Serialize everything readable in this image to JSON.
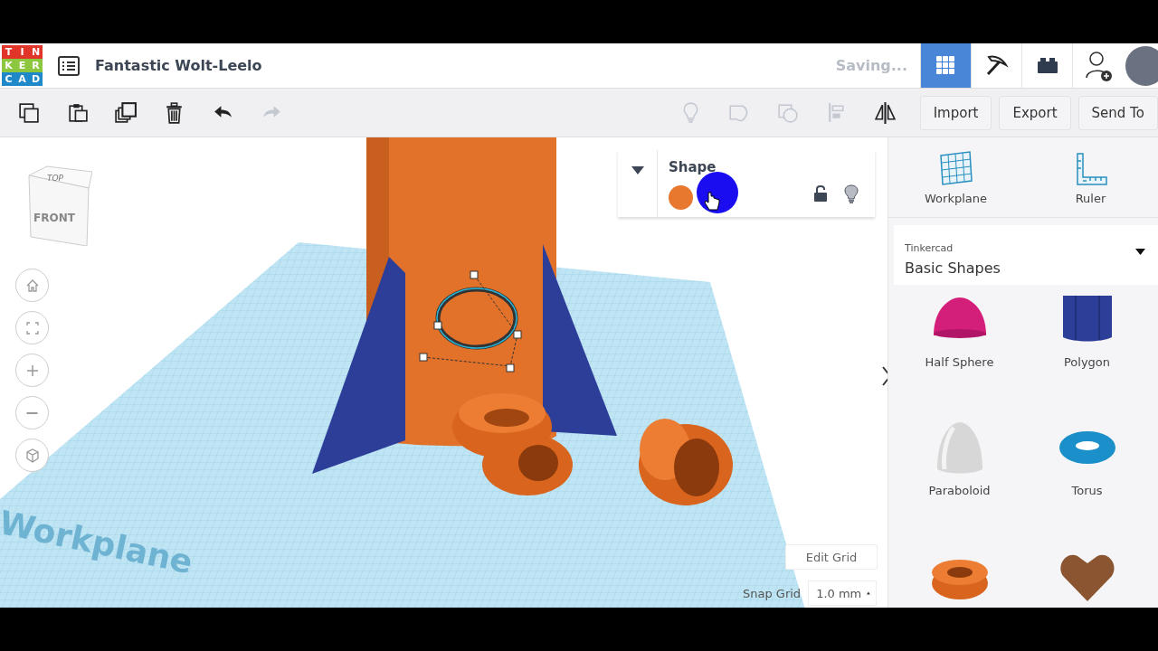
{
  "header": {
    "logo_letters": [
      "T",
      "I",
      "N",
      "K",
      "E",
      "R",
      "C",
      "A",
      "D"
    ],
    "title": "Fantastic Wolt-Leelo",
    "status": "Saving...",
    "views": [
      {
        "kind": "grid",
        "selected": true
      },
      {
        "kind": "pickaxe",
        "selected": false
      },
      {
        "kind": "brick",
        "selected": false
      }
    ]
  },
  "toolbar": {
    "tools": [
      {
        "kind": "copy",
        "disabled": false
      },
      {
        "kind": "paste",
        "disabled": false
      },
      {
        "kind": "duplicate",
        "disabled": false
      },
      {
        "kind": "delete",
        "disabled": false
      },
      {
        "kind": "undo",
        "disabled": false
      },
      {
        "kind": "redo",
        "disabled": true
      },
      {
        "kind": "light",
        "disabled": true
      },
      {
        "kind": "group",
        "disabled": true
      },
      {
        "kind": "ungroup",
        "disabled": true
      },
      {
        "kind": "align",
        "disabled": true
      },
      {
        "kind": "mirror",
        "disabled": false
      }
    ],
    "buttons": [
      "Import",
      "Export",
      "Send To"
    ]
  },
  "view_cube": {
    "top": "TOP",
    "front": "FRONT"
  },
  "workplane_label": "Workplane",
  "inspector": {
    "title": "Shape",
    "swatches": [
      {
        "kind": "solid",
        "color": "#e8782e"
      },
      {
        "kind": "hole",
        "color": "#1a0ef0"
      }
    ],
    "locked": false
  },
  "grid_controls": {
    "edit": "Edit Grid",
    "snap_label": "Snap Grid",
    "snap_value": "1.0 mm"
  },
  "panel": {
    "tools": [
      {
        "kind": "workplane",
        "label": "Workplane"
      },
      {
        "kind": "ruler",
        "label": "Ruler"
      }
    ],
    "library": {
      "source": "Tinkercad",
      "name": "Basic Shapes"
    },
    "shapes": [
      {
        "kind": "half_sphere",
        "label": "Half Sphere"
      },
      {
        "kind": "polygon",
        "label": "Polygon"
      },
      {
        "kind": "paraboloid",
        "label": "Paraboloid"
      },
      {
        "kind": "torus",
        "label": "Torus"
      },
      {
        "kind": "tube"
      },
      {
        "kind": "heart"
      }
    ]
  }
}
